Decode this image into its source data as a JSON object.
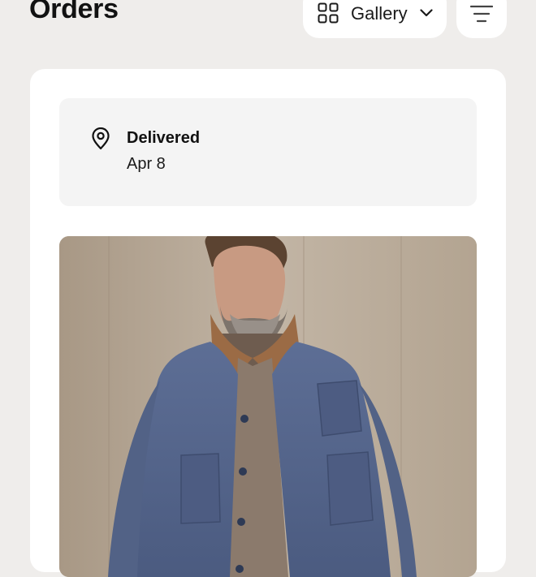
{
  "header": {
    "title": "Orders",
    "view_toggle": {
      "label": "Gallery",
      "icon": "grid-icon",
      "chevron_icon": "chevron-down-icon"
    },
    "filter_icon": "filter-icon"
  },
  "order": {
    "status": {
      "icon": "location-pin-icon",
      "title": "Delivered",
      "date": "Apr 8"
    },
    "image": {
      "subject": "man-in-blue-denim-chore-jacket"
    }
  },
  "colors": {
    "background": "#efedeb",
    "card": "#ffffff",
    "status_panel": "#f4f4f4",
    "text_primary": "#121212"
  }
}
